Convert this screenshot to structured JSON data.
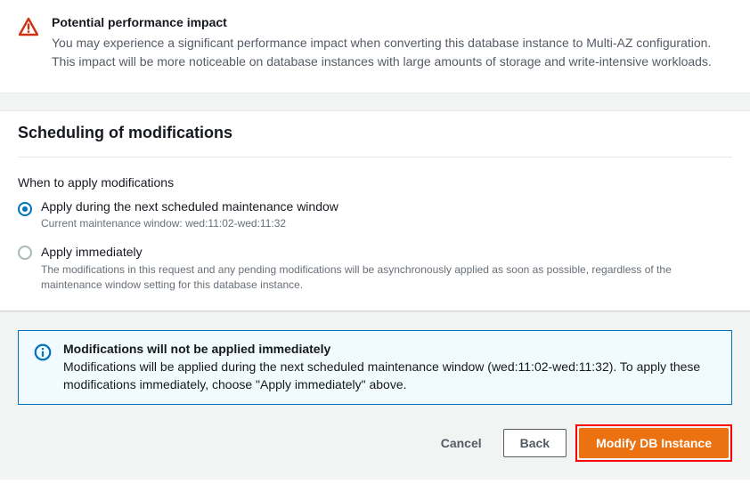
{
  "warning": {
    "title": "Potential performance impact",
    "body": "You may experience a significant performance impact when converting this database instance to Multi-AZ configuration. This impact will be more noticeable on database instances with large amounts of storage and write-intensive workloads."
  },
  "scheduling": {
    "heading": "Scheduling of modifications",
    "field_label": "When to apply modifications",
    "options": [
      {
        "label": "Apply during the next scheduled maintenance window",
        "description": "Current maintenance window: wed:11:02-wed:11:32",
        "selected": true
      },
      {
        "label": "Apply immediately",
        "description": "The modifications in this request and any pending modifications will be asynchronously applied as soon as possible, regardless of the maintenance window setting for this database instance.",
        "selected": false
      }
    ]
  },
  "info": {
    "title": "Modifications will not be applied immediately",
    "body": "Modifications will be applied during the next scheduled maintenance window (wed:11:02-wed:11:32). To apply these modifications immediately, choose \"Apply immediately\" above."
  },
  "buttons": {
    "cancel": "Cancel",
    "back": "Back",
    "primary": "Modify DB Instance"
  }
}
